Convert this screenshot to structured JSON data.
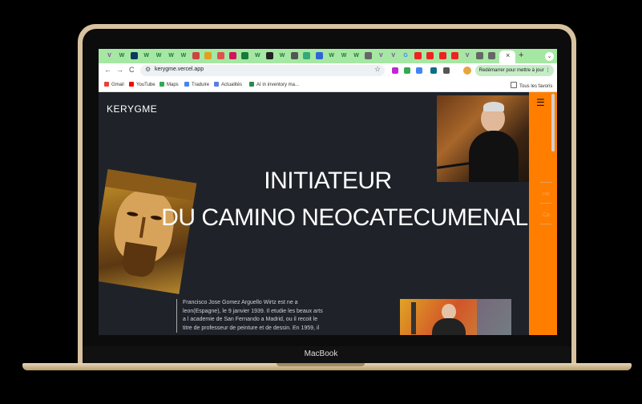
{
  "device": {
    "label": "MacBook"
  },
  "browser": {
    "tabs": [
      "V",
      "W",
      "",
      "W",
      "W",
      "W",
      "W",
      "",
      "",
      "",
      "",
      "",
      "W",
      "",
      "W",
      "",
      "",
      "",
      "W",
      "W",
      "W",
      "",
      "V",
      "V",
      "G",
      "",
      "",
      "",
      "",
      "V",
      "",
      ""
    ],
    "active_tab_close": "×",
    "new_tab": "+",
    "tab_menu": "⌄",
    "back": "←",
    "forward": "→",
    "reload": "C",
    "url": "kerygme.vercel.app",
    "bookmark_star": "☆",
    "restart_label": "Redémarrer pour mettre à jour ⋮",
    "bookmarks": [
      {
        "label": "Gmail",
        "color": "#ea4335"
      },
      {
        "label": "YouTube",
        "color": "#ff0000"
      },
      {
        "label": "Maps",
        "color": "#34a853"
      },
      {
        "label": "Traduire",
        "color": "#4285f4"
      },
      {
        "label": "Actualités",
        "color": "#5b7ee6"
      },
      {
        "label": "AI in inventory ma...",
        "color": "#2c8a4a"
      }
    ],
    "all_bookmarks": "Tous les favoris"
  },
  "page": {
    "site_title": "KERYGME",
    "menu_icon": "☰",
    "nav_items": [
      "Ho",
      "Ca"
    ],
    "headline_line1": "INITIATEUR",
    "headline_line2": "DU CAMINO NEOCATECUMENAL",
    "bio": "Francisco Jose Gomez Arguello Wirtz est ne a leon(Espagne), le 9 janvier 1939. Il etudie les beaux arts a l academie de San Fernando a Madrid, ou il recoit le titre de professeur de peinture et de dessin. En 1959, il"
  },
  "colors": {
    "accent": "#ff7e00",
    "page_bg": "#1f2329",
    "tabbar": "#a6e7a3",
    "frame": "#d8c29f"
  }
}
